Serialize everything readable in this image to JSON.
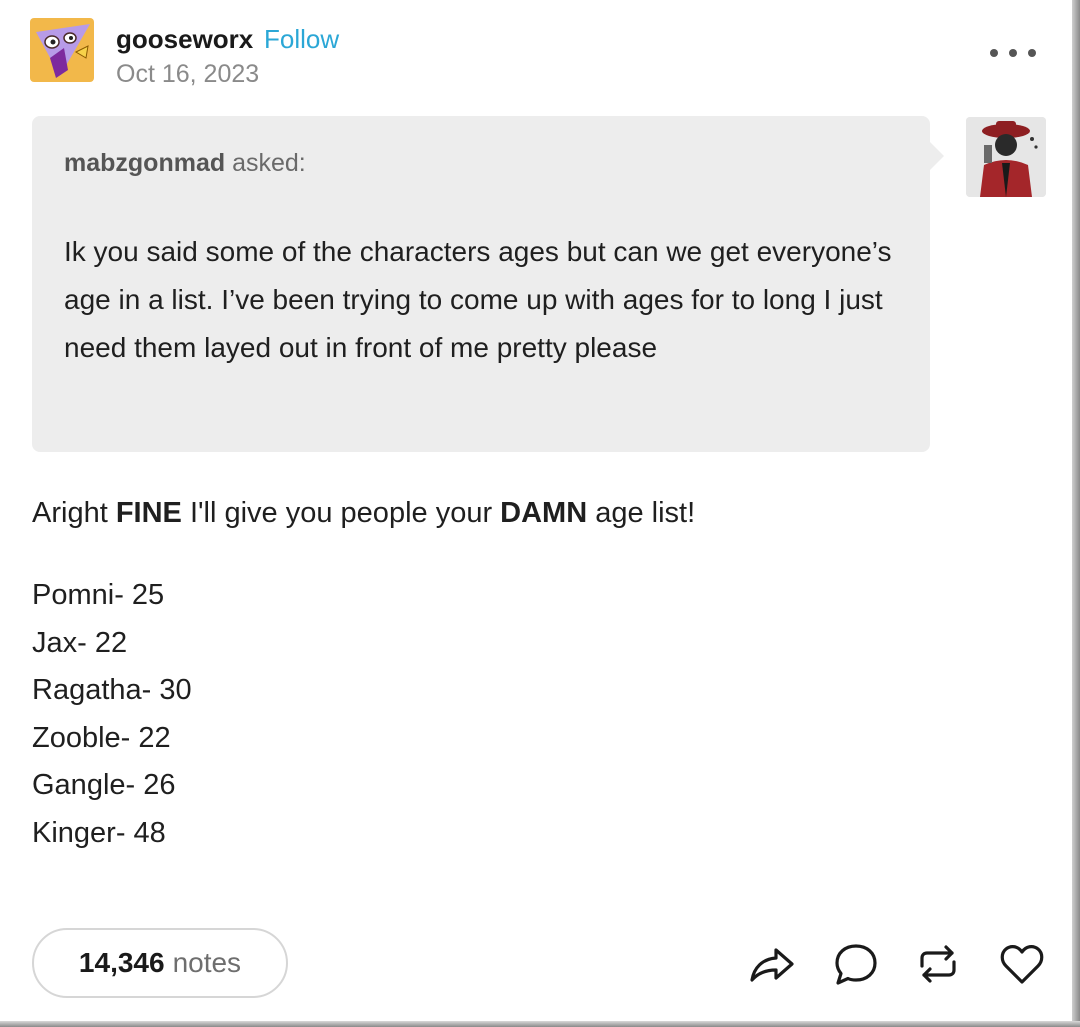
{
  "post": {
    "author": "gooseworx",
    "follow_label": "Follow",
    "date": "Oct 16, 2023"
  },
  "ask": {
    "asker": "mabzgonmad",
    "asked_label": "asked:",
    "question": "Ik you said some of the characters ages but can we get everyone’s age in a list. I’ve been trying to come up with ages for to long I just need them layed out in front of me pretty please"
  },
  "answer": {
    "intro_1": "Aright ",
    "intro_bold_1": "FINE",
    "intro_2": " I'll give you people your ",
    "intro_bold_2": "DAMN",
    "intro_3": " age list!",
    "ages": [
      "Pomni- 25",
      "Jax- 22",
      "Ragatha- 30",
      "Zooble- 22",
      "Gangle- 26",
      "Kinger- 48"
    ]
  },
  "footer": {
    "notes_count": "14,346",
    "notes_label": "notes"
  },
  "icons": {
    "more": "more-horizontal-icon",
    "share": "share-icon",
    "reply": "reply-icon",
    "reblog": "reblog-icon",
    "like": "heart-icon"
  },
  "colors": {
    "follow": "#2ba7d6",
    "ask_background": "#ededed",
    "muted_text": "#8a8a8a"
  }
}
